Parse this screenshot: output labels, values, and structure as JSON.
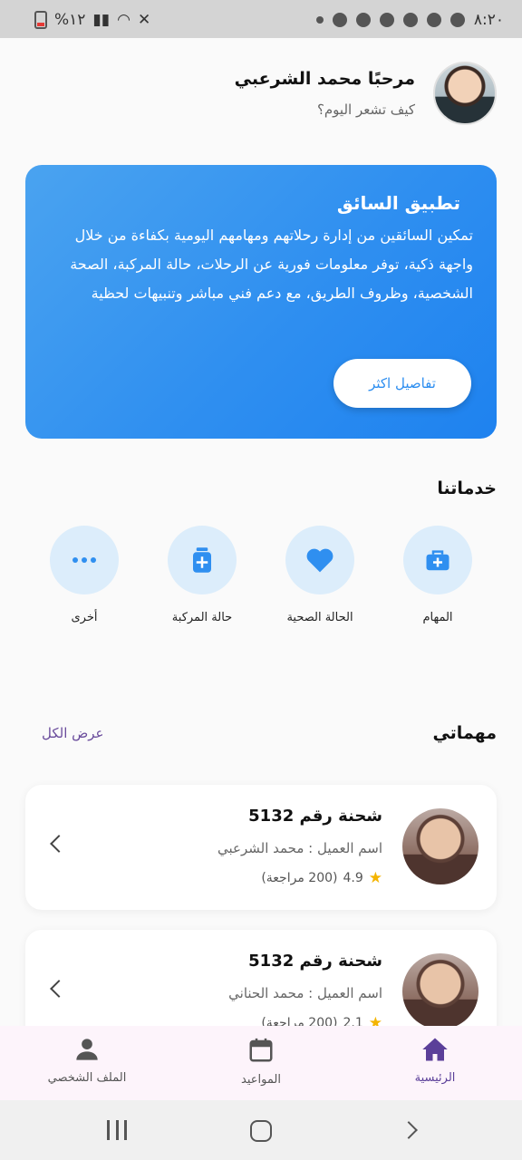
{
  "status_bar": {
    "time": "٨:٢٠",
    "battery": "%١٢"
  },
  "header": {
    "greeting": "مرحبًا محمد الشرعبي",
    "subtitle": "كيف تشعر اليوم؟"
  },
  "banner": {
    "title": "تطبيق السائق",
    "description": "تمكين السائقين من إدارة رحلاتهم ومهامهم اليومية بكفاءة من خلال واجهة ذكية، توفر معلومات فورية عن الرحلات، حالة المركبة، الصحة الشخصية، وظروف الطريق، مع دعم فني مباشر وتنبيهات لحظية",
    "button_label": "تفاصيل اكثر"
  },
  "services": {
    "title": "خدماتنا",
    "items": [
      {
        "label": "المهام",
        "icon": "briefcase-medical-icon"
      },
      {
        "label": "الحالة الصحية",
        "icon": "heart-icon"
      },
      {
        "label": "حالة المركبة",
        "icon": "medical-kit-icon"
      },
      {
        "label": "أخرى",
        "icon": "more-dots-icon"
      }
    ]
  },
  "tasks": {
    "title": "مهماتي",
    "see_all": "عرض الكل",
    "items": [
      {
        "title": "شحنة رقم 5132",
        "client": "اسم العميل : محمد الشرعبي",
        "rating": "4.9",
        "reviews": "(200 مراجعة)"
      },
      {
        "title": "شحنة رقم 5132",
        "client": "اسم العميل : محمد الحناني",
        "rating": "2.1",
        "reviews": "(200 مراجعة)"
      }
    ]
  },
  "bottom_nav": {
    "items": [
      {
        "label": "الرئيسية",
        "icon": "home-icon",
        "active": true
      },
      {
        "label": "المواعيد",
        "icon": "calendar-icon",
        "active": false
      },
      {
        "label": "الملف الشخصي",
        "icon": "person-icon",
        "active": false
      }
    ]
  },
  "colors": {
    "primary": "#2f8ff0",
    "accent": "#5b3f99",
    "service_bg": "#dcedfb",
    "star": "#f4b400"
  }
}
